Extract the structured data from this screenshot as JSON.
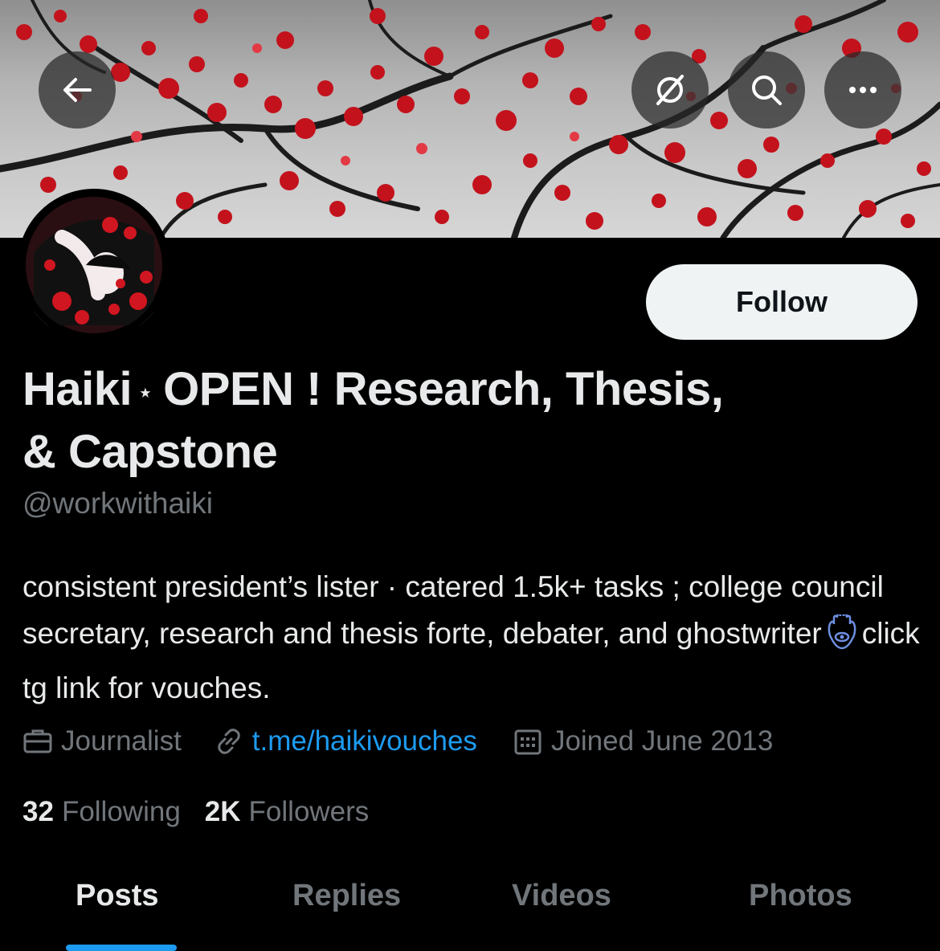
{
  "header": {
    "back_icon": "arrow-left-icon",
    "grok_icon": "grok-icon",
    "search_icon": "search-icon",
    "more_icon": "more-dots-icon",
    "banner_description_colors": [
      "#c0141e",
      "#1a1a1a",
      "#bdbdbd"
    ]
  },
  "profile": {
    "follow_label": "Follow",
    "name_part1": "Haiki",
    "name_star": "⋆",
    "name_part2": "OPEN ! Research, Thesis,",
    "name_line2": "& Capstone",
    "handle": "@workwithaiki",
    "bio_part1": "consistent president’s lister · catered 1.5k+ tasks ; college council secretary, research and thesis forte, debater, and ghostwriter",
    "bio_emoji": "hamsa-icon",
    "bio_part2": "click tg link for vouches.",
    "profession": "Journalist",
    "link": "t.me/haikivouches",
    "joined": "Joined June 2013",
    "following_count": "32",
    "following_label": "Following",
    "followers_count": "2K",
    "followers_label": "Followers"
  },
  "tabs": [
    {
      "label": "Posts",
      "active": true
    },
    {
      "label": "Replies",
      "active": false
    },
    {
      "label": "Videos",
      "active": false
    },
    {
      "label": "Photos",
      "active": false
    }
  ],
  "colors": {
    "accent": "#1d9bf0",
    "background": "#000000",
    "primary_text": "#e7e9ea",
    "secondary_text": "#71767b"
  }
}
